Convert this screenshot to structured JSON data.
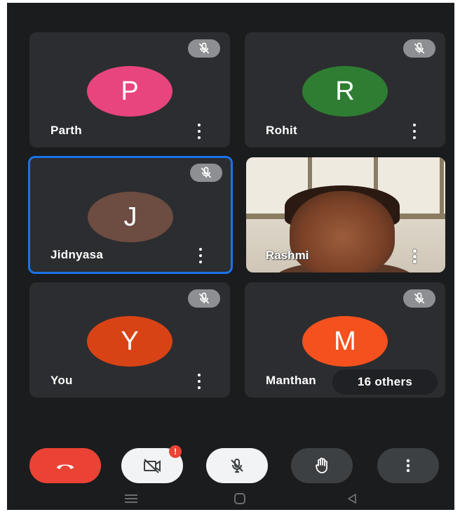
{
  "participants": [
    {
      "name": "Parth",
      "initial": "P",
      "color": "#e8457f"
    },
    {
      "name": "Rohit",
      "initial": "R",
      "color": "#2e7d32"
    },
    {
      "name": "Jidnyasa",
      "initial": "J",
      "color": "#6d4c41"
    },
    {
      "name": "Rashmi"
    },
    {
      "name": "You",
      "initial": "Y",
      "color": "#d84315"
    },
    {
      "name": "Manthan",
      "initial": "M",
      "color": "#f4511e"
    }
  ],
  "others_label": "16 others",
  "controls": {
    "end_call": "end-call-icon",
    "camera": "camera-off-icon",
    "camera_badge": "!",
    "mic": "mic-off-icon",
    "hand": "raise-hand-icon",
    "more": "more-options-icon"
  },
  "colors": {
    "end_call": "#ea4335",
    "active_border": "#1a73e8",
    "tile_bg": "#2c2d30"
  }
}
